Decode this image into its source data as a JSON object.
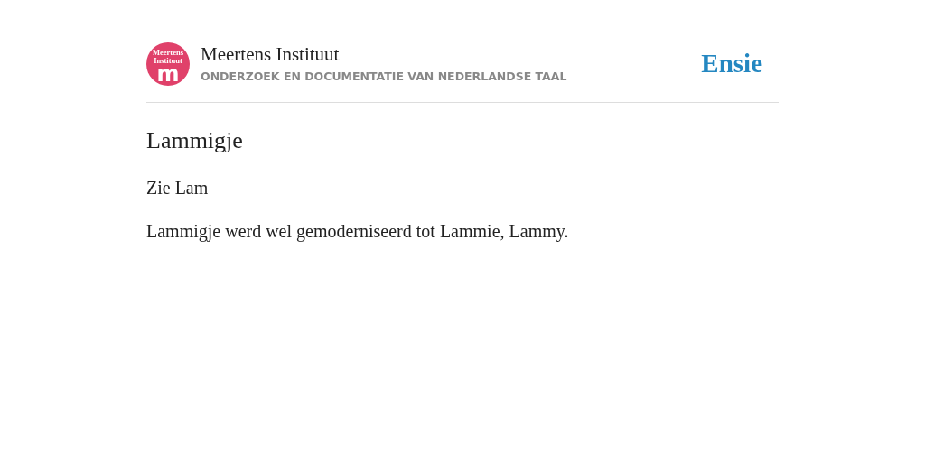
{
  "header": {
    "logo": {
      "lines": [
        "Meertens",
        "Instituut"
      ],
      "mark": "m"
    },
    "name": "Meertens Instituut",
    "tagline": "ONDERZOEK EN DOCUMENTATIE VAN NEDERLANDSE TAAL",
    "site": "Ensie"
  },
  "article": {
    "title": "Lammigje",
    "paragraphs": [
      "Zie Lam",
      "Lammigje werd wel gemoderniseerd tot Lammie, Lammy."
    ]
  }
}
